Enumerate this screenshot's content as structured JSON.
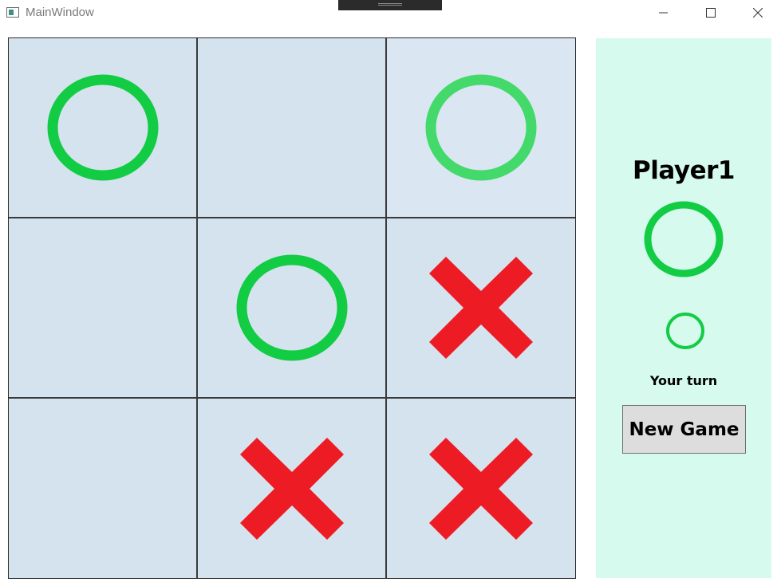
{
  "window": {
    "title": "MainWindow"
  },
  "colors": {
    "o_mark": "#12cc44",
    "o_mark_light": "#44d96b",
    "x_mark": "#ed1c24",
    "cell_bg": "#d5e3ee",
    "panel_bg": "#d6fbee"
  },
  "board": {
    "cells": [
      [
        "O",
        "",
        "O"
      ],
      [
        "",
        "O",
        "X"
      ],
      [
        "",
        "X",
        "X"
      ]
    ]
  },
  "panel": {
    "player_name": "Player1",
    "player_symbol": "O",
    "turn_symbol": "O",
    "turn_text": "Your turn",
    "new_game_label": "New Game"
  },
  "icons": {
    "minimize": "minimize-icon",
    "maximize": "maximize-icon",
    "close": "close-icon"
  }
}
